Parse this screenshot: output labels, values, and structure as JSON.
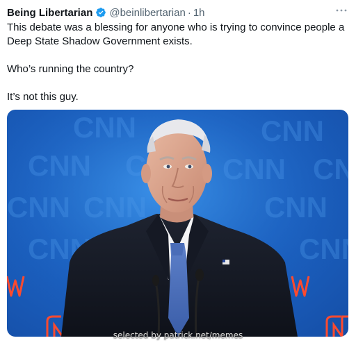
{
  "post": {
    "author": {
      "name": "Being Libertarian",
      "handle": "@beinlibertarian",
      "separator": "·",
      "time": "1h",
      "verified_color": "#1d9bf0"
    },
    "more_icon": "more-horizontal-icon",
    "text": {
      "line1": "This debate was a blessing for anyone who is trying to convince people a Deep State Shadow Government exists.",
      "line2": "Who’s running the country?",
      "line3": "It’s not this guy."
    },
    "media": {
      "background_text": "CNN",
      "background_color": "#1c63c4",
      "neon_color": "#ff4a2e"
    },
    "watermark": "selected by patrick.net/memes"
  }
}
